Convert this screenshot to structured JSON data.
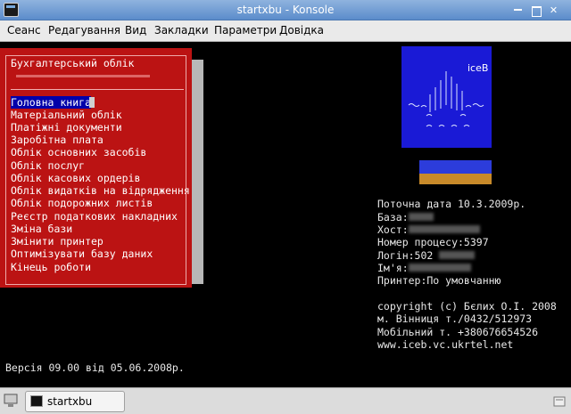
{
  "window": {
    "title": "startxbu - Konsole"
  },
  "menubar": {
    "items": [
      "Сеанс",
      "Редагування",
      "Вид",
      "Закладки",
      "Параметри",
      "Довідка"
    ]
  },
  "menu": {
    "title": "Бухгалтерський облік",
    "items": [
      "Головна книга",
      "Матеріальний облік",
      "Платіжні документи",
      "Заробітна плата",
      "Облік основних засобів",
      "Облік послуг",
      "Облік касових ордерів",
      "Облік видатків на відрядження",
      "Облік подорожних листів",
      "Реєстр податкових накладних",
      "Зміна бази",
      "Змінити принтер",
      "Оптимізувати базу даних",
      "Кінець роботи"
    ],
    "selected_index": 0
  },
  "logo": {
    "text": "iceB",
    "colors": {
      "background": "#1a1ad6",
      "stripe_top": "#2c3cdb",
      "stripe_bottom": "#c88a2a"
    }
  },
  "info": {
    "date": "Поточна дата 10.3.2009р.",
    "base": "База:",
    "host": "Хост:",
    "process": "Номер процесу:5397",
    "login": "Логін:502",
    "name": "Ім'я:",
    "printer": "Принтер:По умовчанню",
    "copyright": "copyright (c) Бєлих О.І. 2008",
    "city": "м. Вінниця т./0432/512973",
    "mobile": "Мобільний т. +380676654526",
    "web": "www.iceb.vc.ukrtel.net"
  },
  "version": "Версія 09.00 від 05.06.2008р.",
  "taskbar": {
    "task_label": "startxbu"
  },
  "colors": {
    "menu_red": "#bb1313",
    "selection_blue": "#0000aa",
    "terminal_bg": "#000000"
  }
}
